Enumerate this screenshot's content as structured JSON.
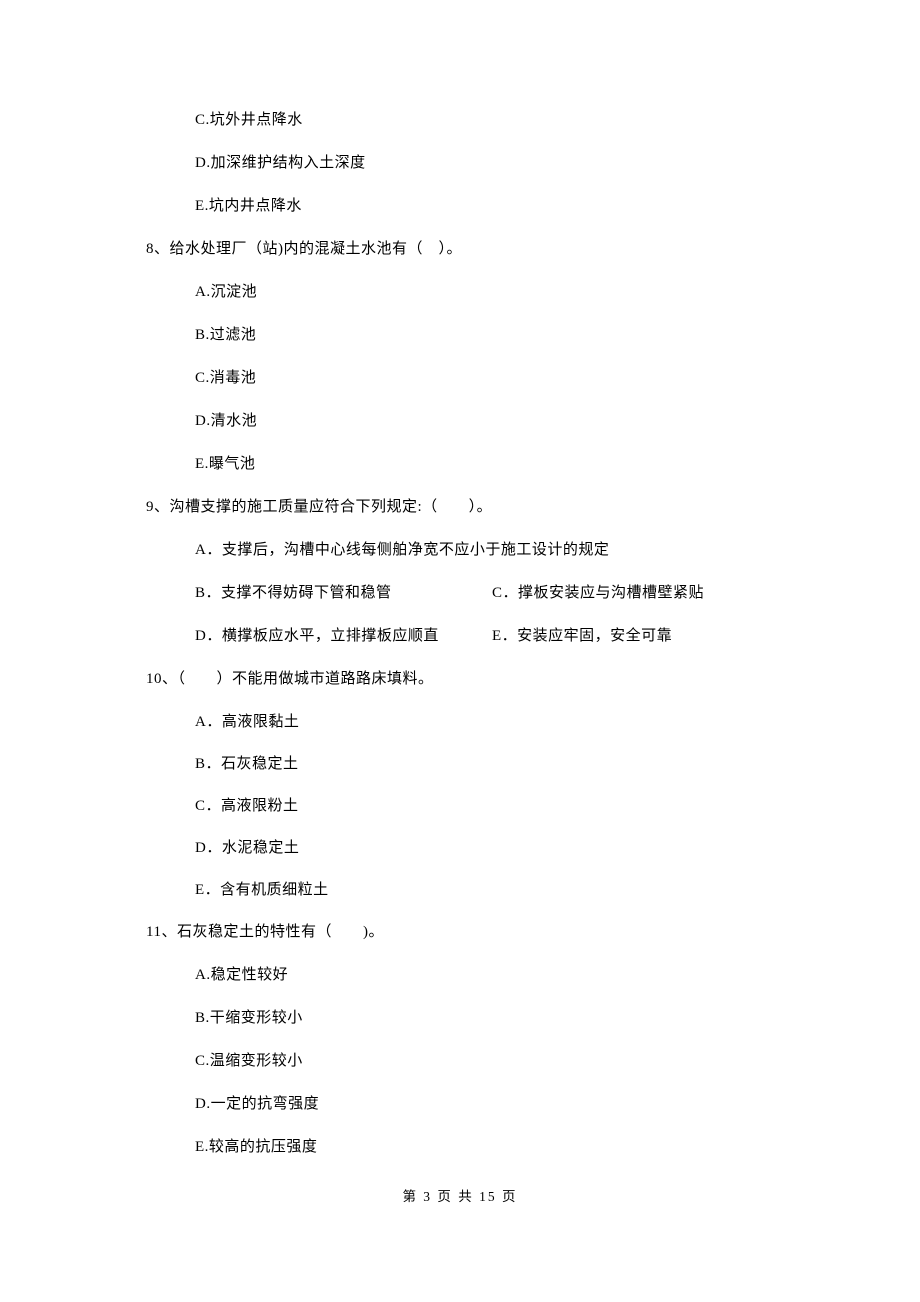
{
  "q7": {
    "optC": "C.坑外井点降水",
    "optD": "D.加深维护结构入土深度",
    "optE": "E.坑内井点降水"
  },
  "q8": {
    "stem": "8、给水处理厂（站)内的混凝土水池有（　）。",
    "optA": "A.沉淀池",
    "optB": "B.过滤池",
    "optC": "C.消毒池",
    "optD": "D.清水池",
    "optE": "E.曝气池"
  },
  "q9": {
    "stem": "9、沟槽支撑的施工质量应符合下列规定:（　　）。",
    "optA": "A．支撑后，沟槽中心线每侧舶净宽不应小于施工设计的规定",
    "optB": "B．支撑不得妨碍下管和稳管",
    "optC": "C．撑板安装应与沟槽槽壁紧贴",
    "optD": "D．横撑板应水平，立排撑板应顺直",
    "optE": "E．安装应牢固，安全可靠"
  },
  "q10": {
    "stem": "10、（　　）不能用做城市道路路床填料。",
    "optA": "A．高液限黏土",
    "optB": "B．石灰稳定土",
    "optC": "C．高液限粉土",
    "optD": "D．水泥稳定土",
    "optE": "E．含有机质细粒土"
  },
  "q11": {
    "stem": "11、石灰稳定土的特性有（　　)。",
    "optA": "A.稳定性较好",
    "optB": "B.干缩变形较小",
    "optC": "C.温缩变形较小",
    "optD": "D.一定的抗弯强度",
    "optE": "E.较高的抗压强度"
  },
  "footer": "第 3 页 共 15 页"
}
